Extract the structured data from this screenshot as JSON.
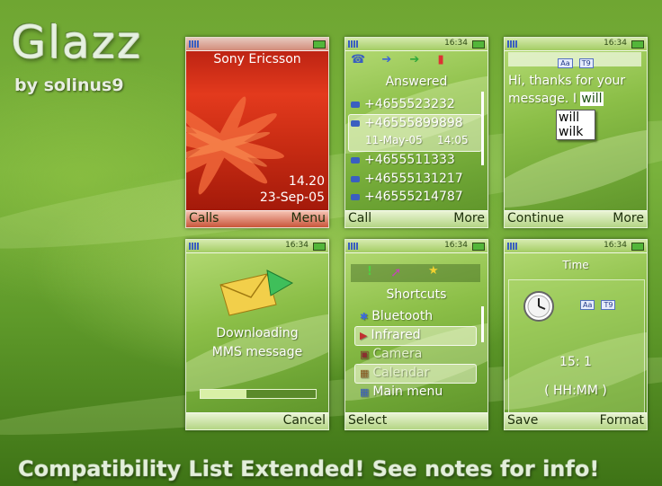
{
  "brand": {
    "title": "Glazz",
    "byline": "by solinus9"
  },
  "footer": "Compatibility List Extended! See notes for info!",
  "screens": {
    "standby": {
      "operator": "Sony Ericsson",
      "time": "14.20",
      "date": "23-Sep-05",
      "left": "Calls",
      "right": "Menu"
    },
    "calls": {
      "clock": "16:34",
      "title": "Answered",
      "items": [
        "+4655523232",
        "+46555899898",
        "+4655511333",
        "+46555131217",
        "+46555214787"
      ],
      "detail_date": "11-May-05",
      "detail_time": "14:05",
      "left": "Call",
      "right": "More"
    },
    "message": {
      "clock": "16:34",
      "text": "Hi, thanks for your message. I",
      "typed": "will",
      "suggestions": [
        "will",
        "wilk"
      ],
      "badge_a": "Aa",
      "badge_b": "T9",
      "left": "Continue",
      "right": "More"
    },
    "download": {
      "clock": "16:34",
      "line1": "Downloading",
      "line2": "MMS message",
      "progress": 0.4,
      "right": "Cancel"
    },
    "shortcuts": {
      "clock": "16:34",
      "title": "Shortcuts",
      "items": [
        "Bluetooth",
        "Infrared",
        "Camera",
        "Calendar",
        "Main menu"
      ],
      "left": "Select"
    },
    "time": {
      "clock": "16:34",
      "title": "Time",
      "value": "15: 1",
      "format": "( HH:MM )",
      "badge_a": "Aa",
      "badge_b": "T9",
      "left": "Save",
      "right": "Format"
    }
  }
}
